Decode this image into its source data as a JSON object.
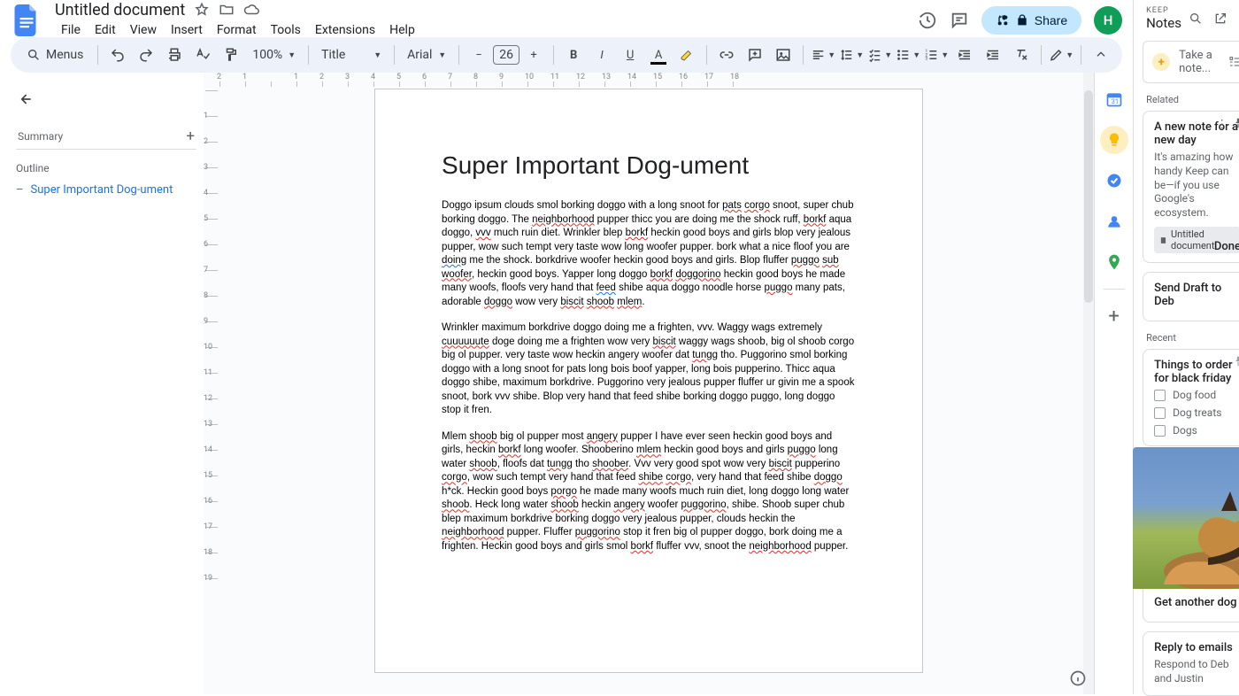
{
  "doc": {
    "title": "Untitled document",
    "menus": [
      "File",
      "Edit",
      "View",
      "Insert",
      "Format",
      "Tools",
      "Extensions",
      "Help"
    ],
    "share": "Share",
    "avatar": "H"
  },
  "toolbar": {
    "menus": "Menus",
    "zoom": "100%",
    "style": "Title",
    "font": "Arial",
    "fontSize": "26"
  },
  "outline": {
    "summary": "Summary",
    "label": "Outline",
    "items": [
      "Super Important Dog-ument"
    ]
  },
  "page": {
    "heading": "Super Important Dog-ument"
  },
  "ruler": {
    "h": [
      "2",
      "1",
      "",
      "1",
      "2",
      "3",
      "4",
      "5",
      "6",
      "7",
      "8",
      "9",
      "10",
      "11",
      "12",
      "13",
      "14",
      "15",
      "16",
      "17",
      "18"
    ],
    "v": [
      "",
      "1",
      "2",
      "3",
      "4",
      "5",
      "6",
      "7",
      "8",
      "9",
      "10",
      "11",
      "12",
      "13",
      "14",
      "15",
      "16",
      "17",
      "18",
      "19"
    ]
  },
  "keep": {
    "brand1": "KEEP",
    "brand2": "Notes",
    "take": "Take a note...",
    "related": "Related",
    "recent": "Recent",
    "note1": {
      "title": "A new note for a new day",
      "body": "It's amazing how handy Keep can be—if you use Google's ecosystem.",
      "chip": "Untitled document",
      "done": "Done"
    },
    "note2": {
      "title": "Send Draft to Deb"
    },
    "note3": {
      "title": "Things to order for black friday",
      "items": [
        "Dog food",
        "Dog treats",
        "Dogs"
      ]
    },
    "note4": {
      "title": "Get another dog"
    },
    "note5": {
      "title": "Reply to emails",
      "body": "Respond to Deb and Justin"
    }
  }
}
